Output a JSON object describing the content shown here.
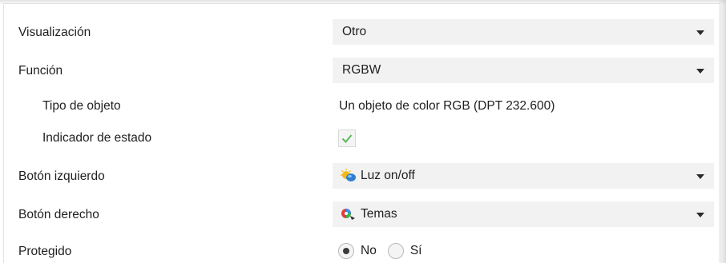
{
  "rows": {
    "visualizacion": {
      "label": "Visualización",
      "value": "Otro"
    },
    "funcion": {
      "label": "Función",
      "value": "RGBW"
    },
    "tipo_objeto": {
      "label": "Tipo de objeto",
      "value": "Un objeto de color RGB (DPT 232.600)"
    },
    "indicador_estado": {
      "label": "Indicador de estado",
      "checked": true
    },
    "boton_izquierdo": {
      "label": "Botón izquierdo",
      "value": "Luz on/off",
      "icon": "light-bulb-sun-icon"
    },
    "boton_derecho": {
      "label": "Botón derecho",
      "value": "Temas",
      "icon": "color-themes-icon"
    },
    "protegido": {
      "label": "Protegido",
      "options": [
        {
          "label": "No",
          "selected": true
        },
        {
          "label": "Sí",
          "selected": false
        }
      ]
    }
  },
  "colors": {
    "select_bg": "#f2f2f2",
    "check_green": "#5bb85b",
    "text": "#1f1f1f"
  }
}
